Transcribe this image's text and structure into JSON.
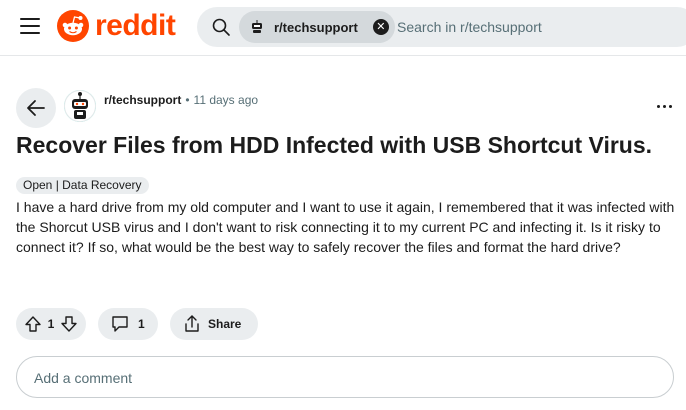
{
  "header": {
    "logo_text": "reddit",
    "brand_color": "#ff4500",
    "search": {
      "community_chip": "r/techsupport",
      "placeholder": "Search in r/techsupport",
      "value": ""
    }
  },
  "post": {
    "subreddit": "r/techsupport",
    "separator": "•",
    "age": "11 days ago",
    "title": "Recover Files from HDD Infected with USB Shortcut Virus.",
    "flair": "Open | Data Recovery",
    "body": "I have a hard drive from my old computer and I want to use it again, I remembered that it was infected with the Shorcut USB virus and I don't want to risk connecting it to my current PC and infecting it. Is it risky to connect it? If so, what would be the best way to safely recover the files and format the hard drive?",
    "vote_count": "1",
    "comment_count": "1",
    "share_label": "Share"
  },
  "comment_box": {
    "placeholder": "Add a comment",
    "value": ""
  },
  "icons": {
    "menu": "hamburger-menu-icon",
    "search": "search-icon",
    "back": "arrow-left-icon",
    "more": "ellipsis-icon",
    "upvote": "arrow-up-icon",
    "downvote": "arrow-down-icon",
    "comment": "comment-bubble-icon",
    "share": "share-icon",
    "clear": "close-icon"
  }
}
